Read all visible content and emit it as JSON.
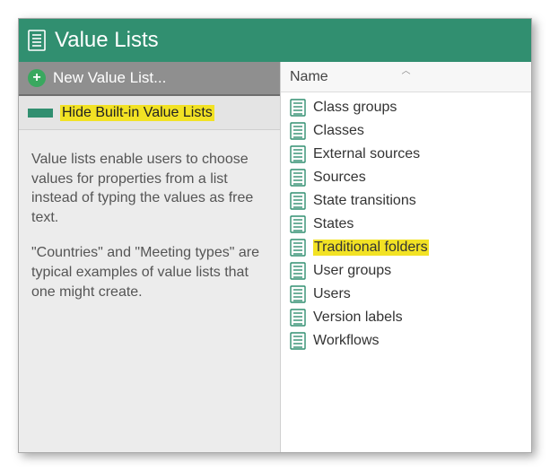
{
  "titlebar": {
    "title": "Value Lists"
  },
  "toolbar": {
    "new_label": "New Value List...",
    "hide_label": "Hide Built-in Value Lists"
  },
  "description": {
    "p1": "Value lists enable users to choose values for properties from a list instead of typing the values as free text.",
    "p2": "\"Countries\" and \"Meeting types\" are typical examples of value lists that one might create."
  },
  "list": {
    "header": "Name",
    "items": [
      {
        "label": "Class groups",
        "highlight": false
      },
      {
        "label": "Classes",
        "highlight": false
      },
      {
        "label": "External sources",
        "highlight": false
      },
      {
        "label": "Sources",
        "highlight": false
      },
      {
        "label": "State transitions",
        "highlight": false
      },
      {
        "label": "States",
        "highlight": false
      },
      {
        "label": "Traditional folders",
        "highlight": true
      },
      {
        "label": "User groups",
        "highlight": false
      },
      {
        "label": "Users",
        "highlight": false
      },
      {
        "label": "Version labels",
        "highlight": false
      },
      {
        "label": "Workflows",
        "highlight": false
      }
    ]
  },
  "colors": {
    "brand_green": "#318f70",
    "highlight_yellow": "#f2e224",
    "toolbar_grey": "#8f8f8f"
  }
}
